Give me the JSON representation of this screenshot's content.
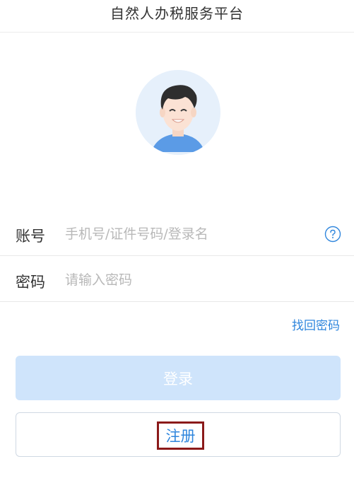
{
  "header": {
    "title": "自然人办税服务平台"
  },
  "avatar": {
    "icon": "user-avatar-icon"
  },
  "form": {
    "account": {
      "label": "账号",
      "value": "",
      "placeholder": "手机号/证件号码/登录名",
      "help_icon": "question-circle-icon"
    },
    "password": {
      "label": "密码",
      "value": "",
      "placeholder": "请输入密码"
    },
    "forgot_password": "找回密码"
  },
  "actions": {
    "login_label": "登录",
    "register_label": "注册"
  },
  "colors": {
    "accent": "#2f86dd",
    "login_button_bg": "#cfe4fb",
    "highlight_box": "#8b1a1a",
    "avatar_bg": "#e6f0fb"
  }
}
